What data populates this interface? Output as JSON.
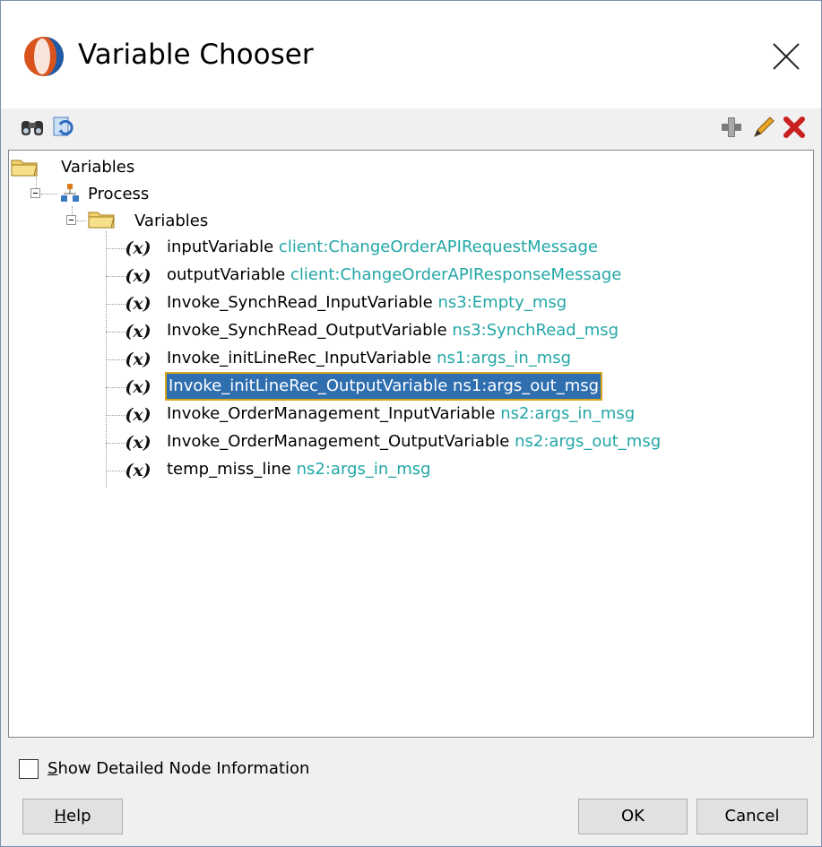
{
  "window": {
    "title": "Variable Chooser"
  },
  "toolbar": {
    "left_icons": [
      "binoculars-icon",
      "refresh-icon"
    ],
    "right_icons": [
      "add-icon",
      "edit-icon",
      "delete-icon"
    ]
  },
  "tree": {
    "root_label": "Variables",
    "process_label": "Process",
    "variables_folder_label": "Variables",
    "items": [
      {
        "name": "inputVariable",
        "type": "client:ChangeOrderAPIRequestMessage",
        "selected": false
      },
      {
        "name": "outputVariable",
        "type": "client:ChangeOrderAPIResponseMessage",
        "selected": false
      },
      {
        "name": "Invoke_SynchRead_InputVariable",
        "type": "ns3:Empty_msg",
        "selected": false
      },
      {
        "name": "Invoke_SynchRead_OutputVariable",
        "type": "ns3:SynchRead_msg",
        "selected": false
      },
      {
        "name": "Invoke_initLineRec_InputVariable",
        "type": "ns1:args_in_msg",
        "selected": false
      },
      {
        "name": "Invoke_initLineRec_OutputVariable",
        "type": "ns1:args_out_msg",
        "selected": true
      },
      {
        "name": "Invoke_OrderManagement_InputVariable",
        "type": "ns2:args_in_msg",
        "selected": false
      },
      {
        "name": "Invoke_OrderManagement_OutputVariable",
        "type": "ns2:args_out_msg",
        "selected": false
      },
      {
        "name": "temp_miss_line",
        "type": "ns2:args_in_msg",
        "selected": false
      }
    ],
    "variable_glyph": "(x)"
  },
  "options": {
    "show_detailed_label_prefix": "S",
    "show_detailed_label_rest": "how Detailed Node Information",
    "checked": false
  },
  "buttons": {
    "help_prefix": "H",
    "help_rest": "elp",
    "ok": "OK",
    "cancel": "Cancel"
  },
  "colors": {
    "type_text": "#23a6a6",
    "selection_outline": "#d6a51c"
  }
}
